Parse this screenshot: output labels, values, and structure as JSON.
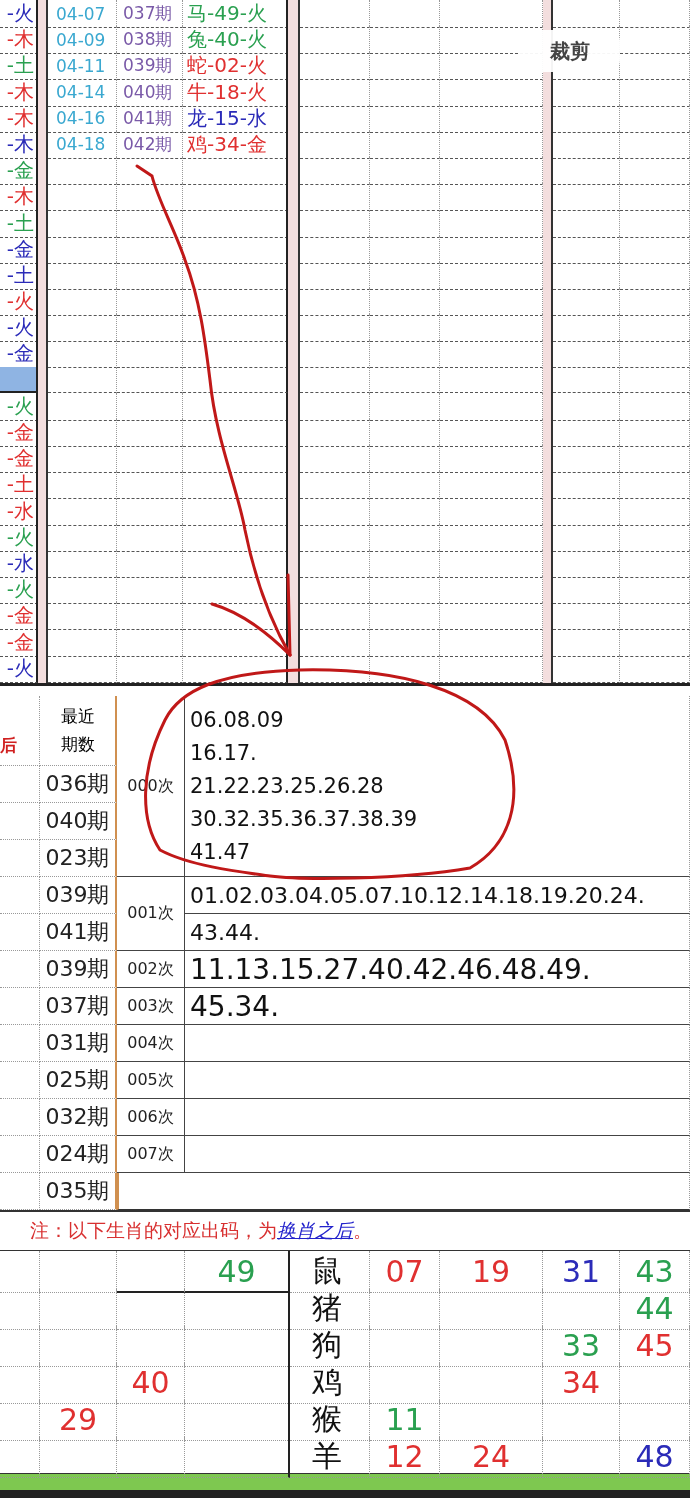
{
  "top_sheet": {
    "side_cells": [
      {
        "text": "-火",
        "color": "#2b2bb8",
        "selected": false
      },
      {
        "text": "-木",
        "color": "#e03030",
        "selected": false
      },
      {
        "text": "-土",
        "color": "#2aa050",
        "selected": false
      },
      {
        "text": "-木",
        "color": "#e03030",
        "selected": false
      },
      {
        "text": "-木",
        "color": "#e03030",
        "selected": false
      },
      {
        "text": "-木",
        "color": "#2b2bb8",
        "selected": false
      },
      {
        "text": "-金",
        "color": "#2aa050",
        "selected": false
      },
      {
        "text": "-木",
        "color": "#e03030",
        "selected": false
      },
      {
        "text": "-土",
        "color": "#2aa050",
        "selected": false
      },
      {
        "text": "-金",
        "color": "#2b2bb8",
        "selected": false
      },
      {
        "text": "-土",
        "color": "#2b2bb8",
        "selected": false
      },
      {
        "text": "-火",
        "color": "#e03030",
        "selected": false
      },
      {
        "text": "-火",
        "color": "#2b2bb8",
        "selected": false
      },
      {
        "text": "-金",
        "color": "#2b2bb8",
        "selected": false
      },
      {
        "selected": true
      },
      {
        "text": "-火",
        "color": "#2aa050",
        "selected": false
      },
      {
        "text": "-金",
        "color": "#e03030",
        "selected": false
      },
      {
        "text": "-金",
        "color": "#e03030",
        "selected": false
      },
      {
        "text": "-土",
        "color": "#e03030",
        "selected": false
      },
      {
        "text": "-水",
        "color": "#e03030",
        "selected": false
      },
      {
        "text": "-火",
        "color": "#2aa050",
        "selected": false
      },
      {
        "text": "-水",
        "color": "#2b2bb8",
        "selected": false
      },
      {
        "text": "-火",
        "color": "#2aa050",
        "selected": false
      },
      {
        "text": "-金",
        "color": "#e03030",
        "selected": false
      },
      {
        "text": "-金",
        "color": "#e03030",
        "selected": false
      },
      {
        "text": "-火",
        "color": "#2b2bb8",
        "selected": false
      }
    ],
    "draws": [
      {
        "date": "04-07",
        "period": "037期",
        "result": "马-49-火",
        "color": "#2aa050"
      },
      {
        "date": "04-09",
        "period": "038期",
        "result": "兔-40-火",
        "color": "#2aa050"
      },
      {
        "date": "04-11",
        "period": "039期",
        "result": "蛇-02-火",
        "color": "#e03030"
      },
      {
        "date": "04-14",
        "period": "040期",
        "result": "牛-18-火",
        "color": "#e03030"
      },
      {
        "date": "04-16",
        "period": "041期",
        "result": "龙-15-水",
        "color": "#2b2bb8"
      },
      {
        "date": "04-18",
        "period": "042期",
        "result": "鸡-34-金",
        "color": "#e03030"
      }
    ]
  },
  "crop_button": "裁剪",
  "frequency": {
    "header_left": "后",
    "header_recent": "最近期数",
    "recent_periods": [
      "036期",
      "040期",
      "023期",
      "039期",
      "041期",
      "039期",
      "037期",
      "031期",
      "025期",
      "032期",
      "024期",
      "035期"
    ],
    "groups": [
      {
        "label": "000次",
        "kind": "merged",
        "lines": [
          "06.08.09",
          "16.17.",
          "21.22.23.25.26.28",
          "30.32.35.36.37.38.39",
          "41.47"
        ]
      },
      {
        "label": "001次",
        "kind": "split",
        "lines": [
          "01.02.03.04.05.07.10.12.14.18.19.20.24.",
          "43.44."
        ]
      },
      {
        "label": "002次",
        "kind": "large",
        "lines": [
          "11.13.15.27.40.42.46.48.49."
        ]
      },
      {
        "label": "003次",
        "kind": "large",
        "lines": [
          "45.34."
        ]
      },
      {
        "label": "004次",
        "kind": "split"
      },
      {
        "label": "005次",
        "kind": "split"
      },
      {
        "label": "006次",
        "kind": "split"
      },
      {
        "label": "007次",
        "kind": "split"
      }
    ]
  },
  "note": {
    "text": "注：以下生肖的对应出码，为",
    "link": "换肖之后",
    "end": "。"
  },
  "zodiac_rows": [
    {
      "left": {
        "column_4": {
          "text": "49",
          "color": "#2aa050"
        }
      },
      "sign": "鼠",
      "numbers": {
        "column_6": {
          "text": "07",
          "color": "#e03030"
        },
        "column_7": {
          "text": "19",
          "color": "#e03030"
        },
        "column_8": {
          "text": "31",
          "color": "#2b2bb8"
        },
        "column_9": {
          "text": "43",
          "color": "#2aa050"
        }
      }
    },
    {
      "sign": "猪",
      "numbers": {
        "column_9": {
          "text": "44",
          "color": "#2aa050"
        }
      }
    },
    {
      "sign": "狗",
      "numbers": {
        "column_8": {
          "text": "33",
          "color": "#2aa050"
        },
        "column_9": {
          "text": "45",
          "color": "#e03030"
        }
      }
    },
    {
      "left": {
        "column_3": {
          "text": "40",
          "color": "#e03030"
        }
      },
      "sign": "鸡",
      "numbers": {
        "column_8": {
          "text": "34",
          "color": "#e03030"
        }
      }
    },
    {
      "left": {
        "column_2": {
          "text": "29",
          "color": "#e03030"
        }
      },
      "sign": "猴",
      "numbers": {
        "column_6": {
          "text": "11",
          "color": "#2aa050"
        }
      }
    },
    {
      "sign": "羊",
      "numbers": {
        "column_6": {
          "text": "12",
          "color": "#e03030"
        },
        "column_7": {
          "text": "24",
          "color": "#e03030"
        },
        "column_9": {
          "text": "48",
          "color": "#2b2bb8"
        }
      }
    }
  ]
}
